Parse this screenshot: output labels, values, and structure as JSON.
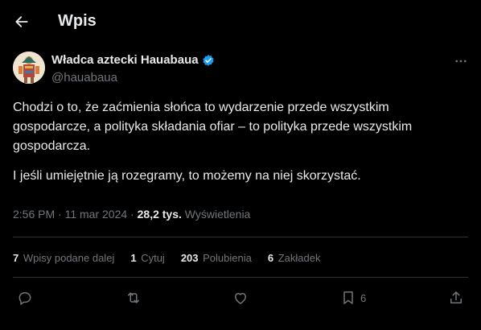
{
  "header": {
    "title": "Wpis"
  },
  "author": {
    "name": "Władca aztecki Hauabaua",
    "handle": "@hauabaua"
  },
  "tweet": {
    "paragraphs": [
      "Chodzi o to, że zaćmienia słońca to wydarzenie przede wszystkim gospodarcze, a polityka składania ofiar – to polityka przede wszystkim gospodarcza.",
      "I jeśli umiejętnie ją rozegramy, to możemy na niej skorzystać."
    ]
  },
  "meta": {
    "time": "2:56 PM",
    "date": "11 mar 2024",
    "separator": " · ",
    "views": "28,2 tys.",
    "views_label": "Wyświetlenia"
  },
  "stats": [
    {
      "num": "7",
      "label": "Wpisy podane dalej"
    },
    {
      "num": "1",
      "label": "Cytuj"
    },
    {
      "num": "203",
      "label": "Polubienia"
    },
    {
      "num": "6",
      "label": "Zakładek"
    }
  ],
  "actions": {
    "bookmark_count": "6"
  },
  "colors": {
    "background": "#000000",
    "text": "#e7e9ea",
    "secondary": "#71767b",
    "verified": "#1d9bf0",
    "divider": "#2f3336"
  },
  "icons": [
    "back-arrow-icon",
    "verified-badge-icon",
    "more-icon",
    "reply-icon",
    "retweet-icon",
    "like-icon",
    "bookmark-icon",
    "share-icon"
  ]
}
